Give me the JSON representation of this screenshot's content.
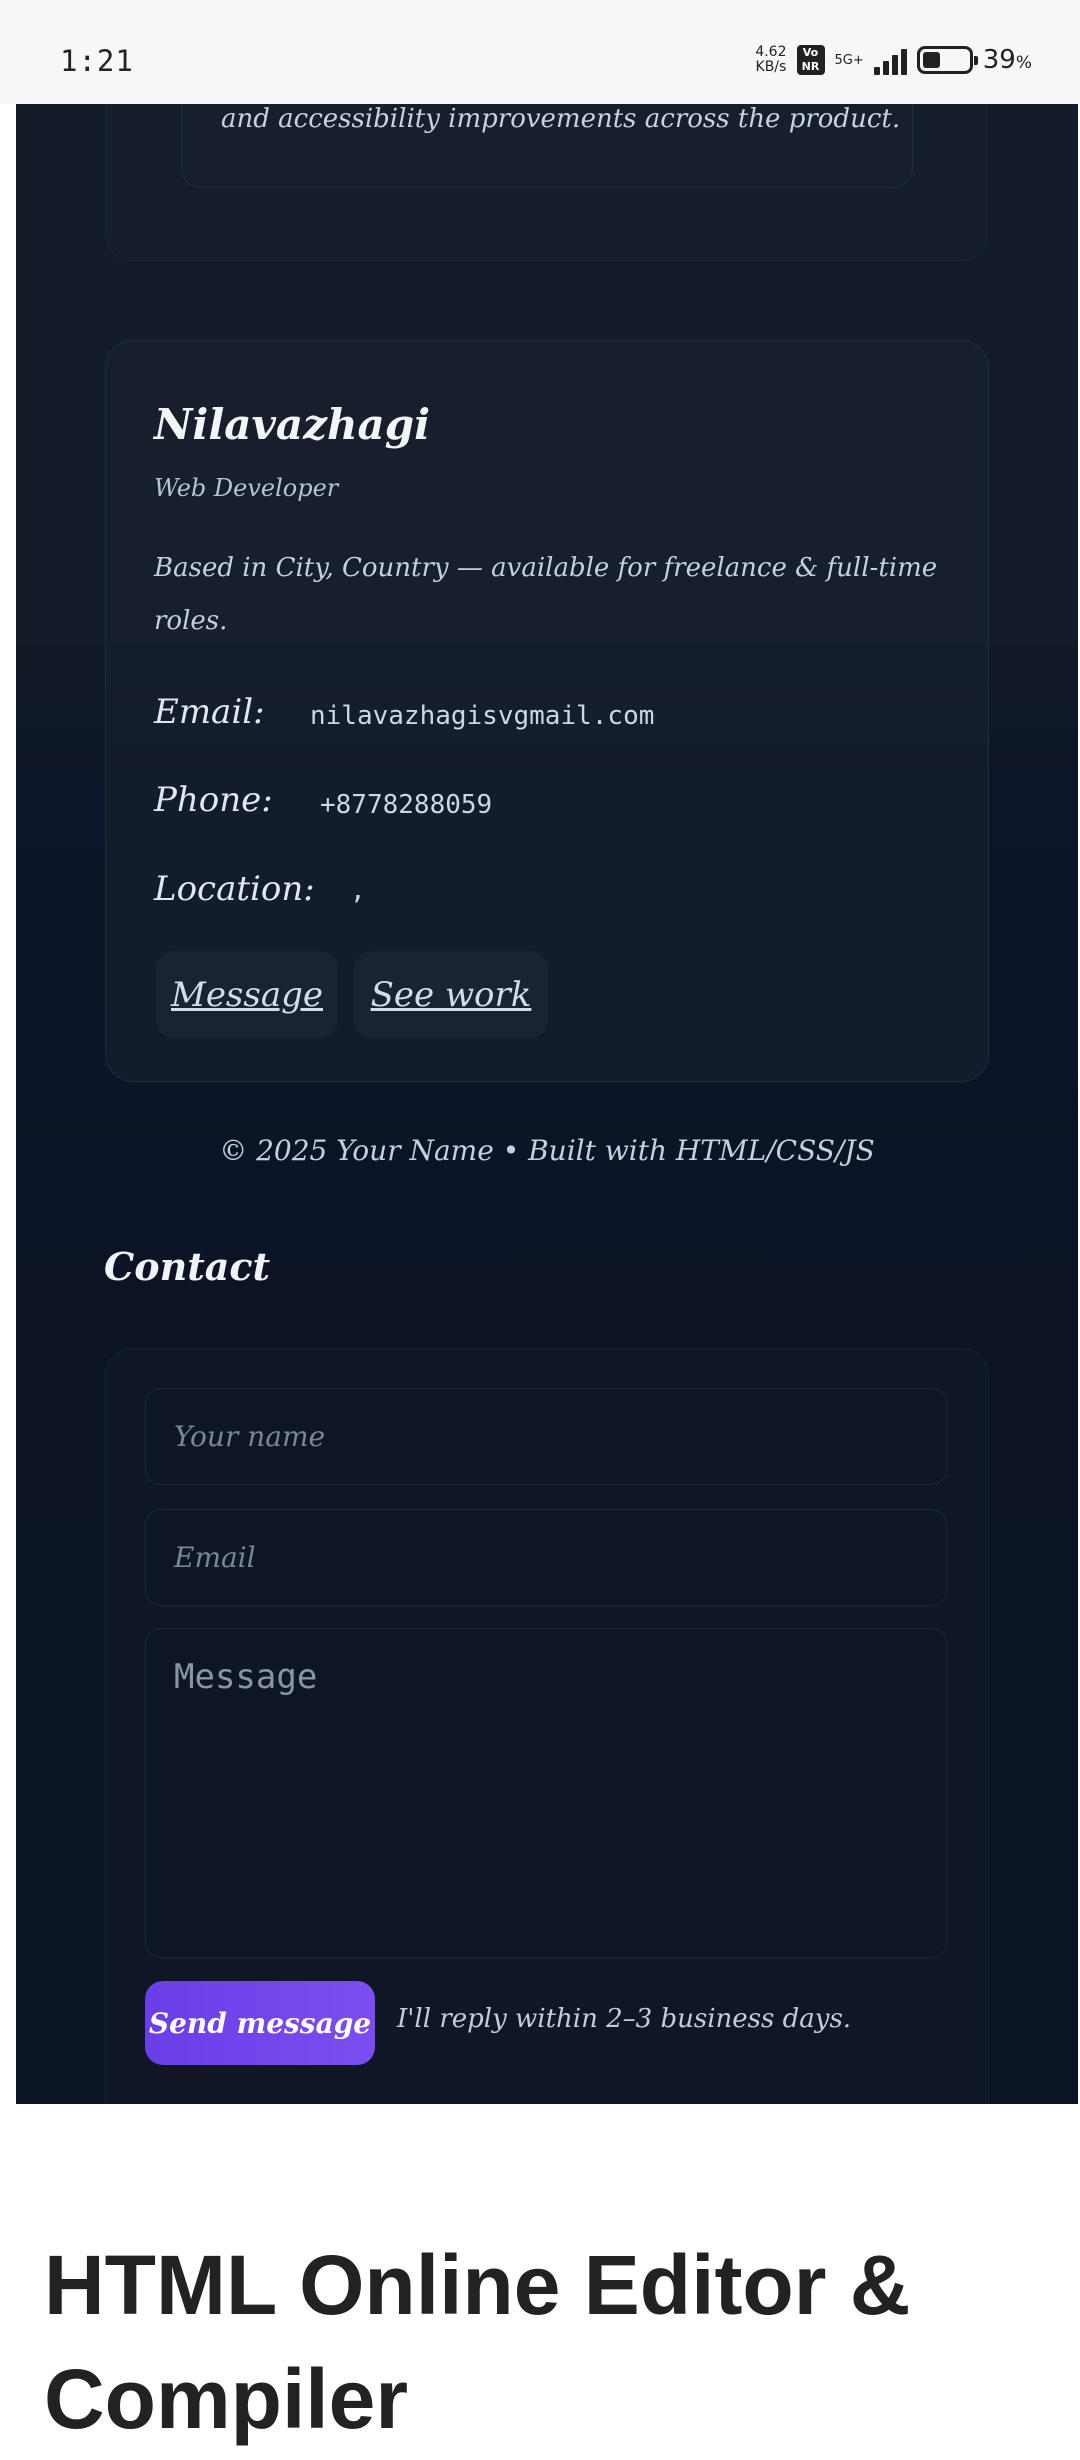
{
  "status_bar": {
    "time": "1:21",
    "net_speed_value": "4.62",
    "net_speed_unit": "KB/s",
    "volte_badge": "Vo NR",
    "network_type": "5G+",
    "battery_percent": "39",
    "battery_unit": "%",
    "battery_level": 0.39,
    "icons": [
      "volte-icon",
      "signal-icon",
      "battery-icon"
    ]
  },
  "preview": {
    "top_card_text": "and accessibility improvements across the product.",
    "profile": {
      "name": "Nilavazhagi",
      "role": "Web Developer",
      "description": "Based in City, Country — available for freelance & full-time roles.",
      "email_label": "Email:",
      "email_value": "nilavazhagisvgmail.com",
      "phone_label": "Phone:",
      "phone_value": "+8778288059",
      "location_label": "Location:",
      "location_value": ",",
      "message_button": "Message",
      "see_work_button": "See work"
    },
    "footer_note": "© 2025 Your Name • Built with HTML/CSS/JS",
    "contact": {
      "title": "Contact",
      "name_placeholder": "Your name",
      "email_placeholder": "Email",
      "message_placeholder": "Message",
      "send_button": "Send message",
      "reply_note": "I'll reply within 2–3 business days."
    }
  },
  "page": {
    "title": "HTML Online Editor & Compiler"
  },
  "colors": {
    "accent": "#6a3ee8",
    "preview_bg": "#0b1325"
  }
}
